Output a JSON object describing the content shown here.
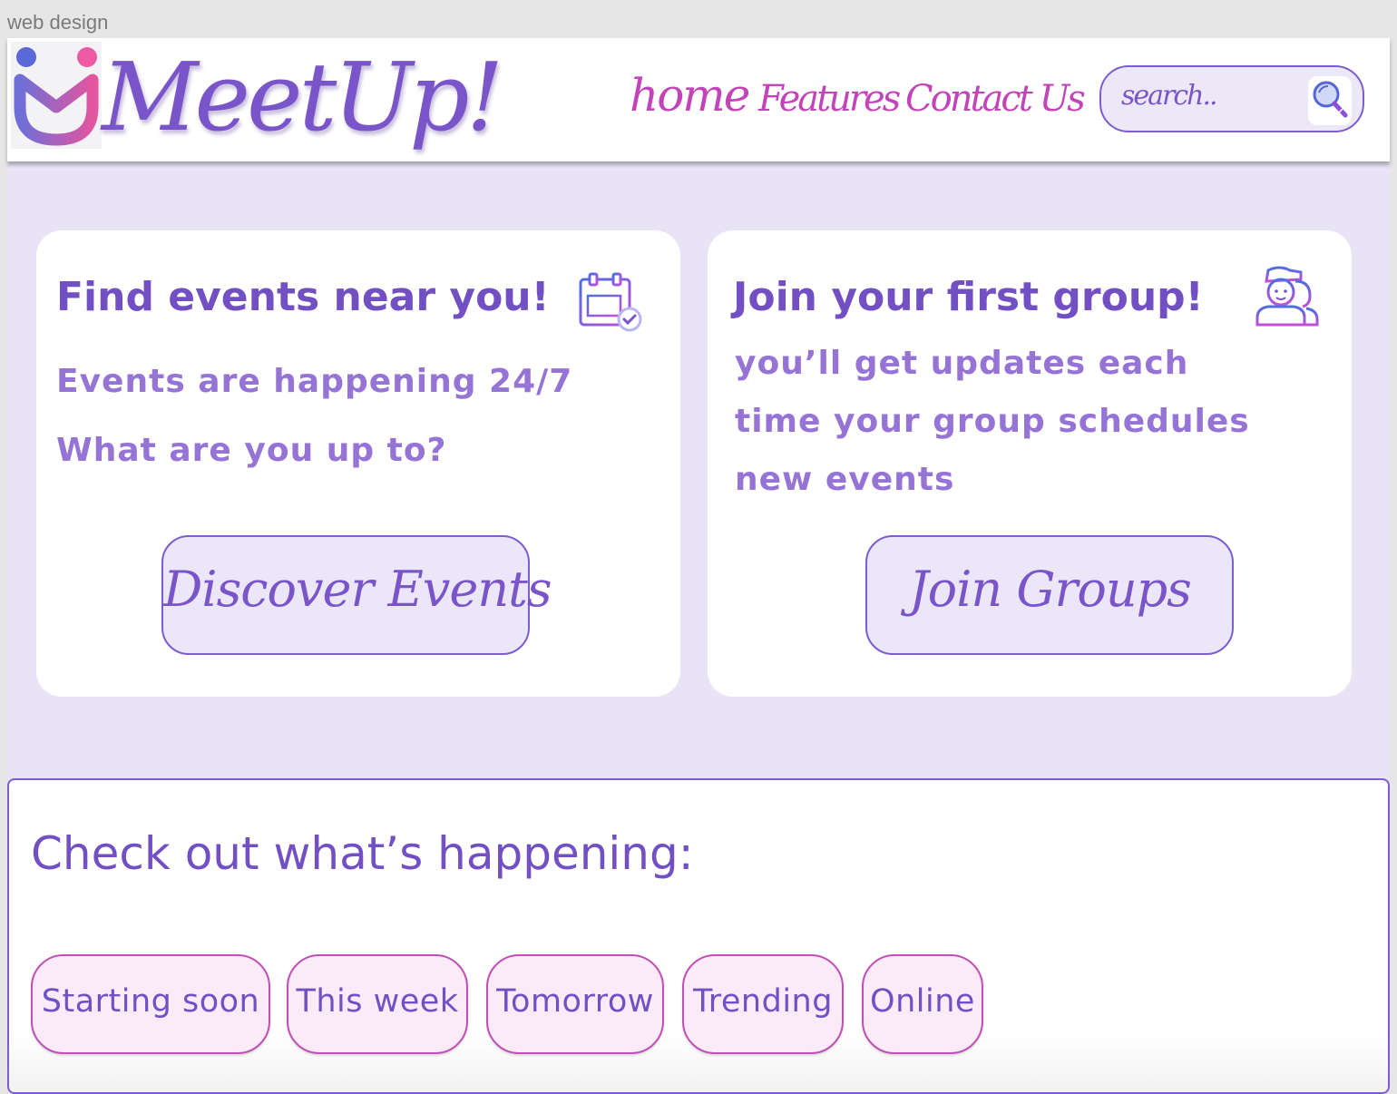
{
  "window": {
    "title": "web design"
  },
  "header": {
    "brand": "MeetUp!",
    "nav": {
      "home": "home",
      "features": "Features",
      "contact": "Contact Us"
    },
    "search": {
      "placeholder": "search.."
    }
  },
  "cards": {
    "events": {
      "title": "Find events near you!",
      "lines": [
        "Events are happening 24/7",
        "What are you up to?"
      ],
      "button": "Discover Events",
      "icon": "calendar-check-icon"
    },
    "groups": {
      "title": "Join your first group!",
      "lines": [
        "you’ll get updates each",
        "time your group schedules",
        "new events"
      ],
      "button": "Join Groups",
      "icon": "group-people-icon"
    }
  },
  "happening": {
    "title": "Check out what’s happening:",
    "chips": [
      "Starting soon",
      "This week",
      "Tomorrow",
      "Trending",
      "Online"
    ]
  },
  "colors": {
    "accent": "#7250c4",
    "nav_pink": "#c244b8",
    "page_bg": "#e8e4f5",
    "chip_bg": "#fbeaf7"
  }
}
